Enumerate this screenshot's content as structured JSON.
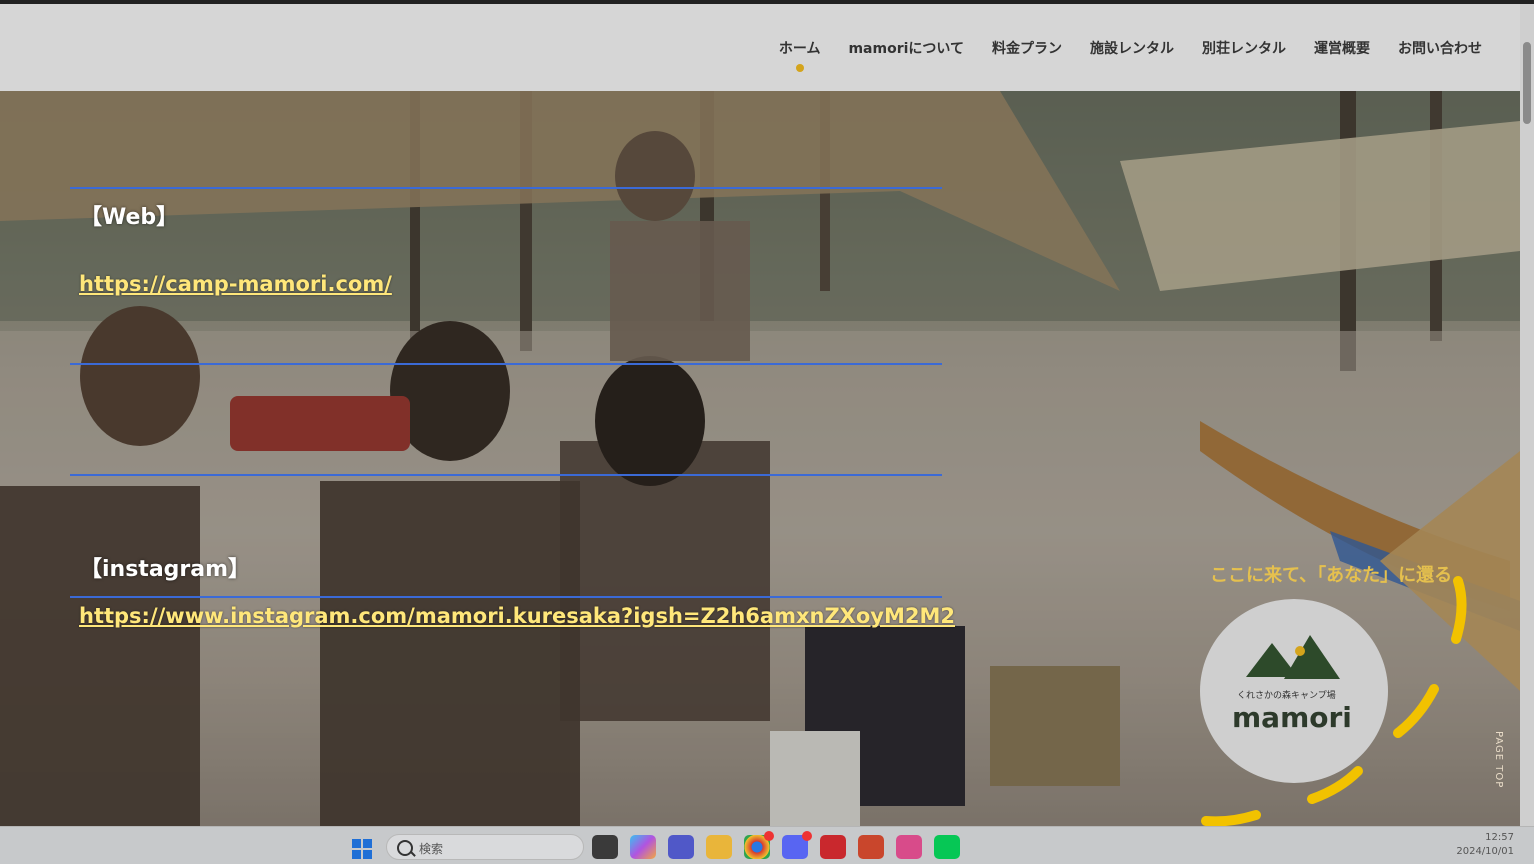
{
  "nav": {
    "items": [
      "ホーム",
      "mamoriについて",
      "料金プラン",
      "施設レンタル",
      "別荘レンタル",
      "運営概要",
      "お問い合わせ"
    ],
    "active_index": 0,
    "accent_color": "#d4a41c"
  },
  "content": {
    "web_label": "【Web】",
    "web_url": "https://camp-mamori.com/",
    "instagram_label": "【instagram】",
    "instagram_url": "https://www.instagram.com/mamori.kuresaka?igsh=Z2h6amxnZXoyM2M2"
  },
  "logo": {
    "name": "mamori",
    "subtitle": "くれさかの森キャンプ場",
    "tagline": "ここに来て、「あなた」に還る"
  },
  "page_top_label": "PAGE TOP",
  "taskbar": {
    "search_placeholder": "検索",
    "time": "12:57",
    "date": "2024/10/01",
    "apps": [
      "file-explorer-dark",
      "copilot",
      "teams",
      "file-explorer",
      "chrome",
      "discord",
      "acrobat",
      "powerpoint",
      "snipping-tool",
      "line"
    ]
  }
}
